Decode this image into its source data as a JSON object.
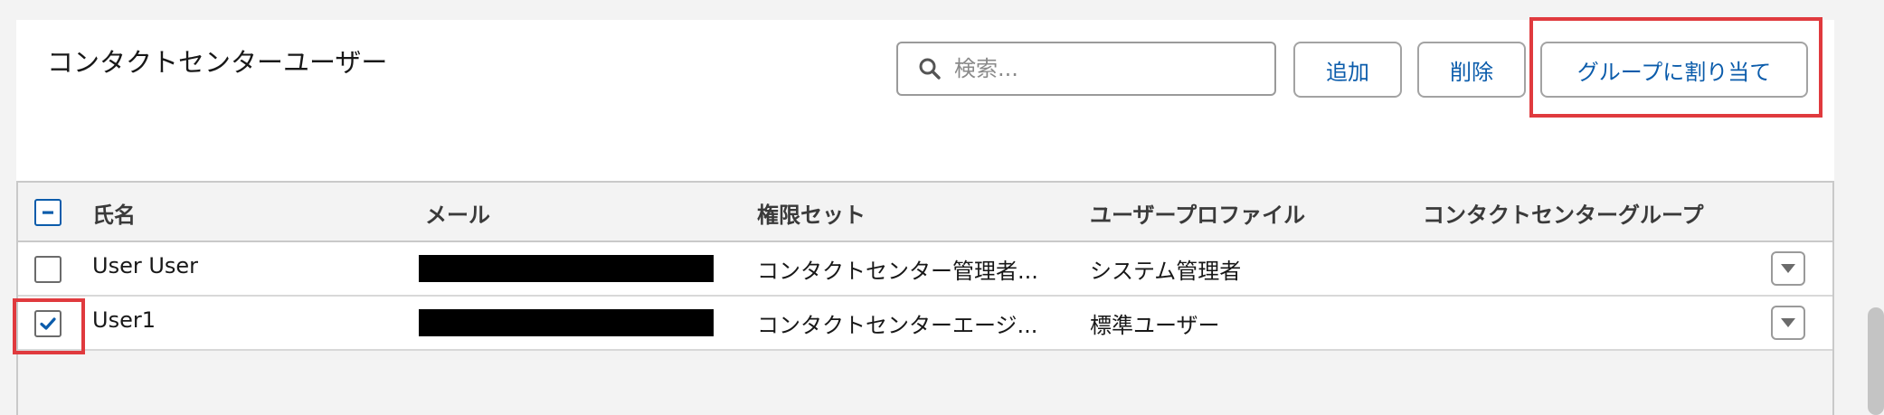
{
  "header": {
    "title": "コンタクトセンターユーザー",
    "search_placeholder": "検索...",
    "search_value": "",
    "add_label": "追加",
    "delete_label": "削除",
    "assign_label": "グループに割り当て"
  },
  "table": {
    "columns": [
      "氏名",
      "メール",
      "権限セット",
      "ユーザープロファイル",
      "コンタクトセンターグループ"
    ],
    "rows": [
      {
        "name": "User User",
        "email": "",
        "permission_set": "コンタクトセンター管理者...",
        "profile": "システム管理者",
        "group": "",
        "checked": false
      },
      {
        "name": "User1",
        "email": "",
        "permission_set": "コンタクトセンターエージ...",
        "profile": "標準ユーザー",
        "group": "",
        "checked": true
      }
    ]
  },
  "colors": {
    "accent": "#0b5cab",
    "highlight": "#e03a3e"
  },
  "icons": {
    "search": "search-icon",
    "row_action": "chevron-down-icon",
    "header_checkbox": "minus-icon",
    "row_checkbox_checked": "checkmark-icon"
  }
}
